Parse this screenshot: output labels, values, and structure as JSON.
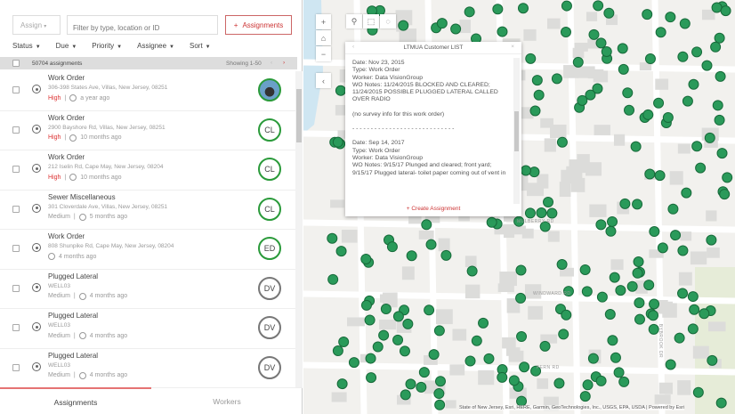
{
  "toolbar": {
    "assign_label": "Assign",
    "filter_placeholder": "Filter by type, location or ID",
    "add_label": "Assignments"
  },
  "filters": [
    "Status",
    "Due",
    "Priority",
    "Assignee",
    "Sort"
  ],
  "list_header": {
    "count": "50704 assignments",
    "showing": "Showing 1-50"
  },
  "assignments": [
    {
      "type": "Work Order",
      "address": "306-398 States Ave, Villas, New Jersey, 08251",
      "priority": "High",
      "time": "a year ago",
      "assignee": "",
      "photo": true,
      "status_color": "#2a9a3a"
    },
    {
      "type": "Work Order",
      "address": "2900 Bayshore Rd, Villas, New Jersey, 08251",
      "priority": "High",
      "time": "10 months ago",
      "assignee": "CL"
    },
    {
      "type": "Work Order",
      "address": "212 Iselin Rd, Cape May, New Jersey, 08204",
      "priority": "High",
      "time": "10 months ago",
      "assignee": "CL"
    },
    {
      "type": "Sewer Miscellaneous",
      "address": "301 Cloverdale Ave, Villas, New Jersey, 08251",
      "priority": "Medium",
      "time": "5 months ago",
      "assignee": "CL"
    },
    {
      "type": "Work Order",
      "address": "808 Shunpike Rd, Cape May, New Jersey, 08204",
      "priority": "",
      "time": "4 months ago",
      "assignee": "ED"
    },
    {
      "type": "Plugged Lateral",
      "address": "WELL03",
      "priority": "Medium",
      "time": "4 months ago",
      "assignee": "DV"
    },
    {
      "type": "Plugged Lateral",
      "address": "WELL03",
      "priority": "Medium",
      "time": "4 months ago",
      "assignee": "DV"
    },
    {
      "type": "Plugged Lateral",
      "address": "WELL03",
      "priority": "Medium",
      "time": "4 months ago",
      "assignee": "DV"
    }
  ],
  "tabs": {
    "assignments": "Assignments",
    "workers": "Workers"
  },
  "map_controls": {
    "zoom_in": "+",
    "zoom_out": "−",
    "collapse": "‹"
  },
  "popup": {
    "title": "LTMUA Customer LIST",
    "records": [
      "Date: Nov 23, 2015\nType: Work Order\nWorker: Data VisionGroup\nWO Notes: 11/24/2015 BLOCKED AND CLEARED; 11/24/2015 POSSIBLE PLUGGED LATERAL CALLED OVER RADIO",
      "(no survey info for this work order)",
      "- - - - - - - - - - - - - - - - - - - - - - - - - - - -",
      "Date: Sep 14, 2017\nType: Work Order\nWorker: Data VisionGroup\nWO Notes: 9/15/17 Plunged and cleared; front yard; 9/15/17 Plugged lateral- toilet paper coming out of vent in"
    ],
    "create_label": "+ Create Assignment"
  },
  "streets": [
    "MULBERRY RD",
    "WINDWARD RD",
    "FERN RD",
    "BYBROOK DR"
  ],
  "attribution": "State of New Jersey, Esri, HERE, Garmin, GeoTechnologies, Inc., USGS, EPA, USDA | Powered by Esri",
  "colors": {
    "accent": "#cc3333",
    "marker": "#2a9a5a",
    "high": "#dd3333"
  }
}
